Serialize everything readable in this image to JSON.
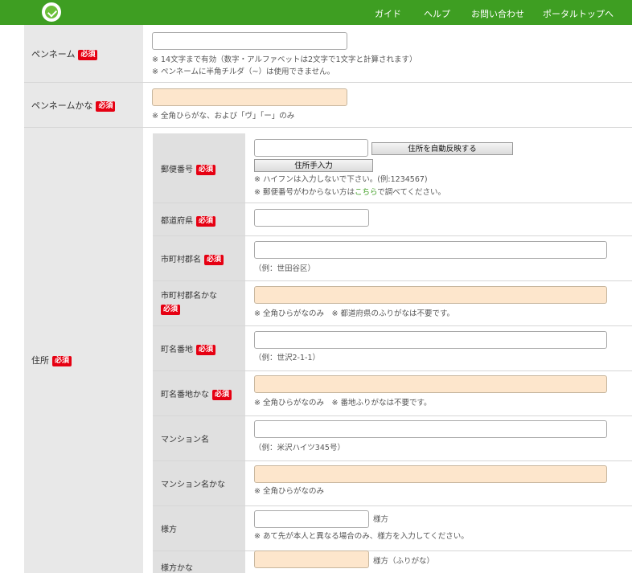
{
  "header": {
    "nav": [
      "ガイド",
      "ヘルプ",
      "お問い合わせ",
      "ポータルトップへ"
    ]
  },
  "required_label": "必須",
  "penname": {
    "label": "ペンネーム",
    "notes": [
      "※ 14文字まで有効（数字・アルファベットは2文字で1文字と計算されます）",
      "※ ペンネームに半角チルダ（~）は使用できません。"
    ]
  },
  "penname_kana": {
    "label": "ペンネームかな",
    "note": "※ 全角ひらがな、および「ヴ」「ー」のみ"
  },
  "address": {
    "label": "住所",
    "postal": {
      "label": "郵便番号",
      "auto_button": "住所を自動反映する",
      "manual_button": "住所手入力",
      "note1": "※ ハイフンは入力しないで下さい。(例:1234567)",
      "note2_pre": "※ 郵便番号がわからない方は",
      "note2_link": "こちら",
      "note2_post": "で調べてください。"
    },
    "prefecture": {
      "label": "都道府県"
    },
    "city": {
      "label": "市町村郡名",
      "note": "（例：世田谷区）"
    },
    "city_kana": {
      "label": "市町村郡名かな",
      "note": "※ 全角ひらがなのみ　※ 都道府県のふりがなは不要です。"
    },
    "street": {
      "label": "町名番地",
      "note": "（例：世沢2-1-1）"
    },
    "street_kana": {
      "label": "町名番地かな",
      "note": "※ 全角ひらがなのみ　※ 番地ふりがなは不要です。"
    },
    "building": {
      "label": "マンション名",
      "note": "（例：米沢ハイツ345号）"
    },
    "building_kana": {
      "label": "マンション名かな",
      "note": "※ 全角ひらがなのみ"
    },
    "care_of": {
      "label": "様方",
      "suffix": "様方",
      "note": "※ あて先が本人と異なる場合のみ、様方を入力してください。"
    },
    "care_of_kana": {
      "label": "様方かな",
      "suffix": "様方（ふりがな）"
    }
  }
}
